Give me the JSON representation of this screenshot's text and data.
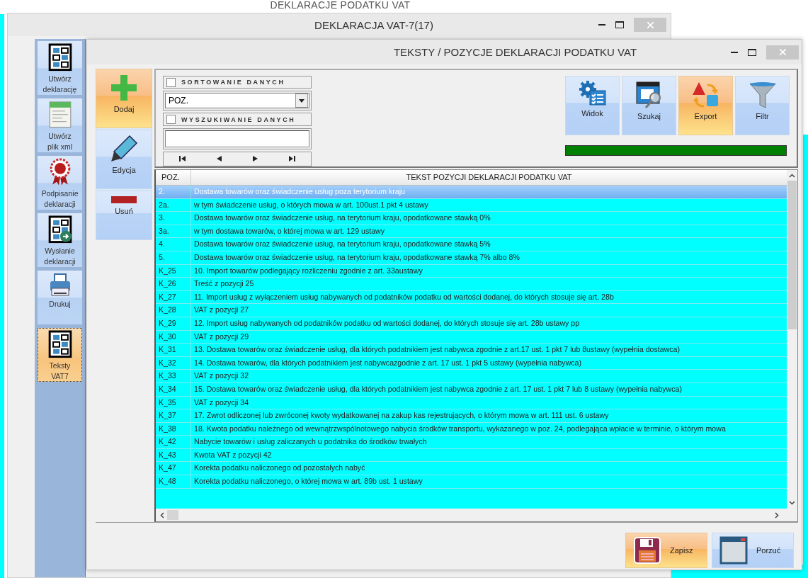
{
  "background_window": {
    "title": "DEKLARACJE PODATKU VAT"
  },
  "window": {
    "title": "DEKLARACJA VAT-7(17)"
  },
  "sidebar": {
    "items": [
      {
        "label": "Utwórz\ndeklarację",
        "kind": "form",
        "selected": false
      },
      {
        "label": "Utwórz\nplik xml",
        "kind": "xml",
        "selected": false
      },
      {
        "label": "Podpisanie\ndeklaracji",
        "kind": "seal",
        "selected": false
      },
      {
        "label": "Wysłanie\ndeklaracji",
        "kind": "send",
        "selected": false
      },
      {
        "label": "Drukuj",
        "kind": "print",
        "selected": false
      },
      {
        "label": "Teksty\nVAT7",
        "kind": "form",
        "selected": true
      }
    ]
  },
  "dialog": {
    "title": "TEKSTY / POZYCJE DEKLARACJI PODATKU VAT",
    "actions": [
      {
        "label": "Dodaj",
        "kind": "add",
        "highlighted": true
      },
      {
        "label": "Edycja",
        "kind": "edit",
        "highlighted": false
      },
      {
        "label": "Usuń",
        "kind": "delete",
        "highlighted": false
      }
    ],
    "sort": {
      "label": "SORTOWANIE DANYCH",
      "checked": false,
      "value": "POZ."
    },
    "search": {
      "label": "WYSZUKIWANIE DANYCH",
      "checked": false
    },
    "toolbar": [
      {
        "label": "Widok",
        "kind": "view",
        "highlighted": false
      },
      {
        "label": "Szukaj",
        "kind": "search",
        "highlighted": false
      },
      {
        "label": "Export",
        "kind": "export",
        "highlighted": true
      },
      {
        "label": "Filtr",
        "kind": "filter",
        "highlighted": false
      }
    ],
    "progress": {
      "level": 1
    },
    "table": {
      "columns": [
        "POZ.",
        "TEKST POZYCJI DEKLARACJI PODATKU VAT"
      ],
      "rows": [
        {
          "cells": [
            "2.",
            "Dostawa towarów oraz świadczenie usług poza terytorium kraju"
          ],
          "selected": true
        },
        {
          "cells": [
            "2a.",
            "w tym świadczenie usług, o których mowa w art. 100ust.1 pkt 4 ustawy"
          ],
          "selected": false
        },
        {
          "cells": [
            "3.",
            "Dostawa towarów oraz świadczenie usług, na terytorium kraju, opodatkowane stawką 0%"
          ],
          "selected": false
        },
        {
          "cells": [
            "3a.",
            "w tym dostawa towarów, o której mowa w art. 129 ustawy"
          ],
          "selected": false
        },
        {
          "cells": [
            "4.",
            "Dostawa towarów oraz świadczenie usług, na terytorium kraju, opodatkowane stawką 5%"
          ],
          "selected": false
        },
        {
          "cells": [
            "5.",
            "Dostawa towarów oraz świadczenie usług, na terytorium kraju, opodatkowane stawką 7% albo 8%"
          ],
          "selected": false
        },
        {
          "cells": [
            "K_25",
            "10. Import towarów podlegający rozliczeniu zgodnie z art. 33austawy"
          ],
          "selected": false
        },
        {
          "cells": [
            "K_26",
            "Treść z pozycji 25"
          ],
          "selected": false
        },
        {
          "cells": [
            "K_27",
            "11. Import usług z wyłączeniem usług nabywanych od podatników podatku od wartości dodanej, do których stosuje się art. 28b"
          ],
          "selected": false
        },
        {
          "cells": [
            "K_28",
            "VAT z pozycji 27"
          ],
          "selected": false
        },
        {
          "cells": [
            "K_29",
            "12. Import usług nabywanych od podatników podatku od wartości dodanej, do których stosuje się art. 28b ustawy pp"
          ],
          "selected": false
        },
        {
          "cells": [
            "K_30",
            "VAT z pozycji 29"
          ],
          "selected": false
        },
        {
          "cells": [
            "K_31",
            "13. Dostawa towarów oraz świadczenie usług, dla których podatnikiem jest nabywca zgodnie z art.17 ust. 1 pkt 7 lub 8ustawy (wypełnia dostawca)"
          ],
          "selected": false
        },
        {
          "cells": [
            "K_32",
            "14. Dostawa towarów, dla których podatnikiem jest nabywcazgodnie z art. 17 ust. 1 pkt 5 ustawy (wypełnia nabywca)"
          ],
          "selected": false
        },
        {
          "cells": [
            "K_33",
            "VAT z pozycji 32"
          ],
          "selected": false
        },
        {
          "cells": [
            "K_34",
            "15. Dostawa towarów oraz świadczenie usług, dla których podatnikiem jest nabywca zgodnie z art. 17 ust. 1 pkt 7 lub 8 ustawy (wypełnia nabywca)"
          ],
          "selected": false
        },
        {
          "cells": [
            "K_35",
            "VAT z pozycji 34"
          ],
          "selected": false
        },
        {
          "cells": [
            "K_37",
            "17. Zwrot odliczonej lub zwróconej kwoty wydatkowanej na zakup kas rejestrujących, o którym mowa w art. 111 ust. 6 ustawy"
          ],
          "selected": false
        },
        {
          "cells": [
            "K_38",
            "18. Kwota podatku należnego od wewnątrzwspólnotowego nabycia środków transportu, wykazanego w poz. 24, podlegająca wpłacie w terminie, o którym mowa"
          ],
          "selected": false
        },
        {
          "cells": [
            "K_42",
            "Nabycie towarów i usług zaliczanych u podatnika do środków trwałych"
          ],
          "selected": false
        },
        {
          "cells": [
            "K_43",
            "Kwota VAT z pozycji 42"
          ],
          "selected": false
        },
        {
          "cells": [
            "K_47",
            "Korekta podatku naliczonego od pozostałych nabyć"
          ],
          "selected": false
        },
        {
          "cells": [
            "K_48",
            "Korekta podatku naliczonego, o której mowa w art. 89b ust. 1 ustawy"
          ],
          "selected": false
        }
      ]
    },
    "buttons": [
      {
        "label": "Zapisz",
        "kind": "save",
        "highlighted": true
      },
      {
        "label": "Porzuć",
        "kind": "discard",
        "highlighted": false
      }
    ]
  }
}
